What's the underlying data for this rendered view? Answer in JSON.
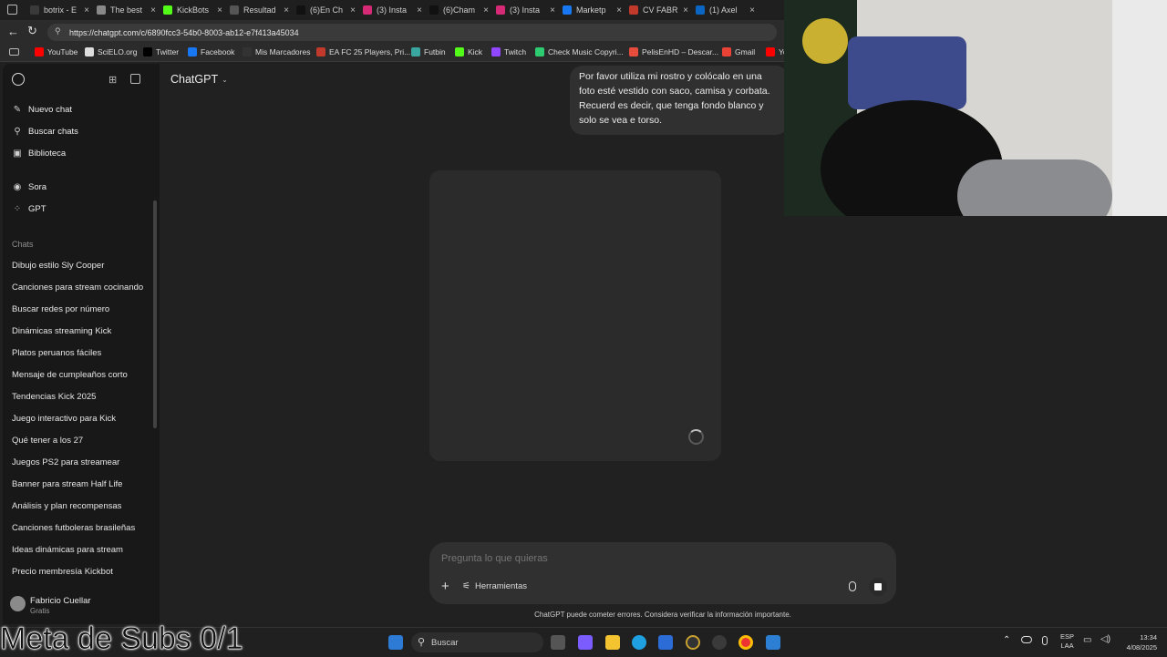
{
  "tabs": [
    {
      "label": "botrix - E",
      "color": "#3a3a3a"
    },
    {
      "label": "The best",
      "color": "#888888"
    },
    {
      "label": "KickBots",
      "color": "#53fc18"
    },
    {
      "label": "Resultad",
      "color": "#555555"
    },
    {
      "label": "(6)En Ch",
      "color": "#111111"
    },
    {
      "label": "(3) Insta",
      "color": "#d62976"
    },
    {
      "label": "(6)Cham",
      "color": "#111111"
    },
    {
      "label": "(3) Insta",
      "color": "#d62976"
    },
    {
      "label": "Marketp",
      "color": "#1877f2"
    },
    {
      "label": "CV FABR",
      "color": "#c0392b"
    },
    {
      "label": "(1) Axel",
      "color": "#0a66c2"
    }
  ],
  "address": {
    "url": "https://chatgpt.com/c/6890fcc3-54b0-8003-ab12-e7f413a45034"
  },
  "bookmarks": [
    {
      "label": "YouTube",
      "color": "#ff0000"
    },
    {
      "label": "SciELO.org",
      "color": "#dddddd"
    },
    {
      "label": "Twitter",
      "color": "#000000"
    },
    {
      "label": "Facebook",
      "color": "#1877f2"
    },
    {
      "label": "Mis Marcadores",
      "color": "#333333"
    },
    {
      "label": "EA FC 25 Players, Pri...",
      "color": "#c0392b"
    },
    {
      "label": "Futbin",
      "color": "#3aa6a0"
    },
    {
      "label": "Kick",
      "color": "#53fc18"
    },
    {
      "label": "Twitch",
      "color": "#9146ff"
    },
    {
      "label": "Check Music Copyri...",
      "color": "#2ecc71"
    },
    {
      "label": "PelisEnHD – Descar...",
      "color": "#e74c3c"
    },
    {
      "label": "Gmail",
      "color": "#ea4335"
    },
    {
      "label": "Yo",
      "color": "#ff0000"
    }
  ],
  "sidebar": {
    "new_chat": "Nuevo chat",
    "search_chats": "Buscar chats",
    "library": "Biblioteca",
    "sora": "Sora",
    "gpt": "GPT",
    "chats_heading": "Chats",
    "chats": [
      "Dibujo estilo Sly Cooper",
      "Canciones para stream cocinando",
      "Buscar redes por número",
      "Dinámicas streaming Kick",
      "Platos peruanos fáciles",
      "Mensaje de cumpleaños corto",
      "Tendencias Kick 2025",
      "Juego interactivo para Kick",
      "Qué tener a los 27",
      "Juegos PS2 para streamear",
      "Banner para stream Half Life",
      "Análisis y plan recompensas",
      "Canciones futboleras brasileñas",
      "Ideas dinámicas para stream",
      "Precio membresía Kickbot"
    ],
    "user_name": "Fabricio Cuellar",
    "user_plan": "Gratis"
  },
  "header": {
    "model": "ChatGPT"
  },
  "message": {
    "text": "Por favor utiliza mi rostro y colócalo en una foto esté vestido con saco, camisa y corbata. Recuerd es decir, que tenga fondo blanco y solo se vea e torso."
  },
  "composer": {
    "placeholder": "Pregunta lo que quieras",
    "tools_label": "Herramientas"
  },
  "disclaimer": "ChatGPT puede cometer errores. Considera verificar la información importante.",
  "overlay": {
    "text": "Meta de Subs 0/1"
  },
  "taskbar": {
    "search_placeholder": "Buscar",
    "lang": "ESP",
    "lang_sub": "LAA",
    "time": "13:34",
    "date": "4/08/2025"
  }
}
